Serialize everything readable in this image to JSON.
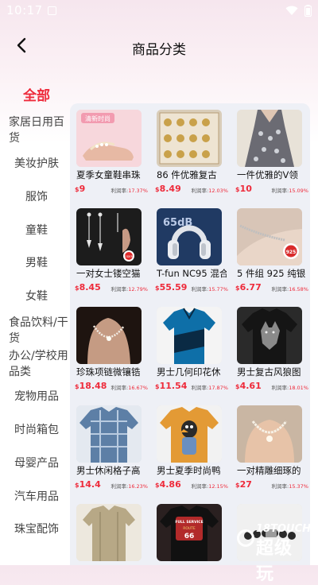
{
  "status_bar": {
    "time": "10:17"
  },
  "header": {
    "title": "商品分类"
  },
  "sidebar": {
    "items": [
      {
        "label": "全部"
      },
      {
        "label": "家居日用百货"
      },
      {
        "label": "美妆护肤"
      },
      {
        "label": "服饰"
      },
      {
        "label": "童鞋"
      },
      {
        "label": "男鞋"
      },
      {
        "label": "女鞋"
      },
      {
        "label": "食品饮料/干货"
      },
      {
        "label": "办公/学校用品类"
      },
      {
        "label": "宠物用品"
      },
      {
        "label": "时尚箱包"
      },
      {
        "label": "母婴产品"
      },
      {
        "label": "汽车用品"
      },
      {
        "label": "珠宝配饰"
      }
    ]
  },
  "products": [
    {
      "title": "夏季女童鞋串珠",
      "currency": "$",
      "price": "9",
      "profit_label": "利润率:",
      "profit": "17.37%"
    },
    {
      "title": "86 件优雅复古",
      "currency": "$",
      "price": "8.49",
      "profit_label": "利润率:",
      "profit": "12.03%"
    },
    {
      "title": "一件优雅的V领",
      "currency": "$",
      "price": "10",
      "profit_label": "利润率:",
      "profit": "15.09%"
    },
    {
      "title": "一对女士镂空猫",
      "currency": "$",
      "price": "8.45",
      "profit_label": "利润率:",
      "profit": "12.79%"
    },
    {
      "title": "T-fun NC95 混合",
      "currency": "$",
      "price": "55.59",
      "profit_label": "利润率:",
      "profit": "15.77%"
    },
    {
      "title": "5 件组 925 纯银",
      "currency": "$",
      "price": "6.77",
      "profit_label": "利润率:",
      "profit": "16.58%"
    },
    {
      "title": "珍珠项链微镶锆",
      "currency": "$",
      "price": "18.48",
      "profit_label": "利润率:",
      "profit": "16.67%"
    },
    {
      "title": "男士几何印花休",
      "currency": "$",
      "price": "11.54",
      "profit_label": "利润率:",
      "profit": "17.87%"
    },
    {
      "title": "男士复古风狼图",
      "currency": "$",
      "price": "4.61",
      "profit_label": "利润率:",
      "profit": "18.01%"
    },
    {
      "title": "男士休闲格子高",
      "currency": "$",
      "price": "14.4",
      "profit_label": "利润率:",
      "profit": "16.23%"
    },
    {
      "title": "男士夏季时尚鸭",
      "currency": "$",
      "price": "4.86",
      "profit_label": "利润率:",
      "profit": "12.15%"
    },
    {
      "title": "一对精雕细琢的",
      "currency": "$",
      "price": "27",
      "profit_label": "利润率:",
      "profit": "15.37%"
    }
  ],
  "thumb_texts": {
    "p0_banner": "清新时尚",
    "p4_badge": "65dB",
    "p3_tag": "ODER",
    "p5_tag": "925",
    "p13_line1": "FULL SERVICE",
    "p13_line2": "ROUTE",
    "p13_line3": "66"
  },
  "watermark": {
    "top": "18TOUCH",
    "main": "超级玩"
  },
  "colors": {
    "accent": "#ee2b3b",
    "panel": "#eef0f6"
  }
}
